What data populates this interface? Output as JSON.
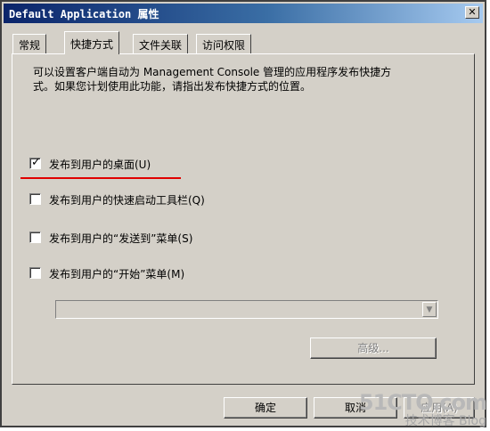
{
  "window": {
    "title": "Default Application 属性",
    "close_symbol": "✕"
  },
  "tabs": [
    {
      "label": "常规",
      "active": false
    },
    {
      "label": "快捷方式",
      "active": true
    },
    {
      "label": "文件关联",
      "active": false
    },
    {
      "label": "访问权限",
      "active": false
    }
  ],
  "panel": {
    "description_line1": "可以设置客户端自动为 Management Console 管理的应用程序发布快捷方",
    "description_line2": "式。如果您计划使用此功能，请指出发布快捷方式的位置。",
    "options": [
      {
        "label": "发布到用户的桌面(U)",
        "checked": true
      },
      {
        "label": "发布到用户的快速启动工具栏(Q)",
        "checked": false
      },
      {
        "label": "发布到用户的“发送到”菜单(S)",
        "checked": false
      },
      {
        "label": "发布到用户的“开始”菜单(M)",
        "checked": false
      }
    ],
    "dropdown_value": "",
    "advanced_button": "高级..."
  },
  "footer": {
    "ok_button": "确定",
    "cancel_button": "取消",
    "apply_button": "应用(A)"
  },
  "watermark": {
    "main": "51CTO.com",
    "sub": "技术博客 Blog"
  },
  "colors": {
    "titlebar_start": "#0a246a",
    "titlebar_end": "#a6caf0",
    "dialog_bg": "#d4d0c8",
    "annotation_red": "#e00000"
  },
  "icons": {
    "check": "checkmark-icon",
    "dropdown": "chevron-down-icon"
  }
}
